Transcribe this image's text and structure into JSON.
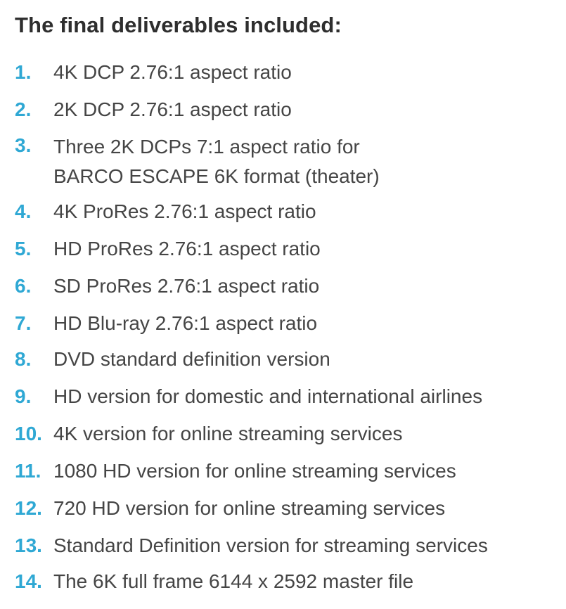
{
  "heading": "The final deliverables included:",
  "accent_color": "#2fa8d4",
  "text_color": "#454545",
  "items": [
    {
      "number": "1.",
      "text": "4K DCP 2.76:1 aspect ratio"
    },
    {
      "number": "2.",
      "text": "2K DCP 2.76:1 aspect ratio"
    },
    {
      "number": "3.",
      "text": "Three 2K DCPs 7:1 aspect ratio for\nBARCO ESCAPE 6K format (theater)"
    },
    {
      "number": "4.",
      "text": "4K ProRes 2.76:1 aspect ratio"
    },
    {
      "number": "5.",
      "text": "HD ProRes 2.76:1 aspect ratio"
    },
    {
      "number": "6.",
      "text": "SD ProRes 2.76:1 aspect ratio"
    },
    {
      "number": "7.",
      "text": "HD Blu-ray 2.76:1 aspect ratio"
    },
    {
      "number": "8.",
      "text": "DVD standard definition version"
    },
    {
      "number": "9.",
      "text": "HD version for domestic and international airlines"
    },
    {
      "number": "10.",
      "text": "4K version for online streaming services"
    },
    {
      "number": "11.",
      "text": "1080 HD version for online streaming services"
    },
    {
      "number": "12.",
      "text": "720 HD version for online streaming services"
    },
    {
      "number": "13.",
      "text": "Standard Definition version for streaming services"
    },
    {
      "number": "14.",
      "text": "The 6K full frame 6144 x 2592 master file"
    }
  ]
}
